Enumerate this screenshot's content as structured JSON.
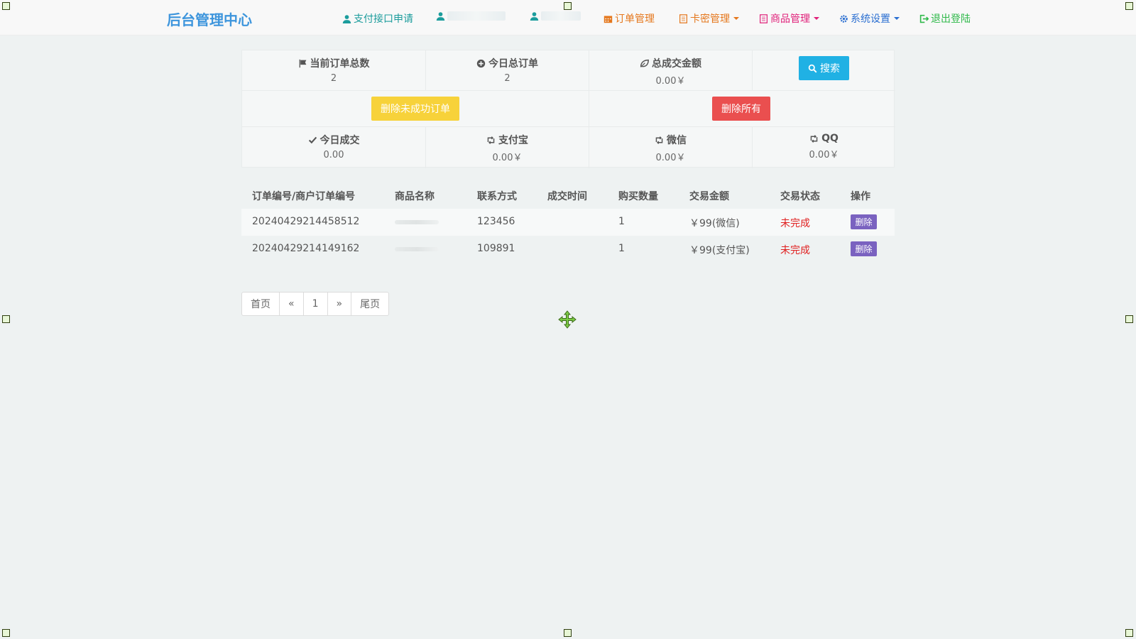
{
  "navbar": {
    "brand": "后台管理中心",
    "items": [
      {
        "label": "支付接口申请",
        "icon": "user-icon"
      },
      {
        "label": "",
        "icon": "user-icon"
      },
      {
        "label": "",
        "icon": "user-icon"
      },
      {
        "label": "订单管理",
        "icon": "calendar-icon"
      },
      {
        "label": "卡密管理",
        "icon": "list-icon"
      },
      {
        "label": "商品管理",
        "icon": "list-icon"
      },
      {
        "label": "系统设置",
        "icon": "gear-icon"
      },
      {
        "label": "退出登陆",
        "icon": "logout-icon"
      }
    ],
    "colors": {
      "brand": "#3d95dc",
      "teal": "#1b9c9c",
      "orange": "#e5771d",
      "pink": "#e0217a",
      "blue": "#2b6fd1",
      "green": "#2fb94a"
    }
  },
  "stats": {
    "current_orders": {
      "label": "当前订单总数",
      "value": "2",
      "icon": "flag-icon"
    },
    "today_orders": {
      "label": "今日总订单",
      "value": "2",
      "icon": "plus-circle-icon"
    },
    "total_amount": {
      "label": "总成交金额",
      "value": "0.00￥",
      "icon": "leaf-icon"
    },
    "search_label": "搜索",
    "delete_failed_label": "删除未成功订单",
    "delete_all_label": "删除所有",
    "today_deal": {
      "label": "今日成交",
      "value": "0.00",
      "icon": "check-icon"
    },
    "alipay": {
      "label": "支付宝",
      "value": "0.00￥",
      "icon": "retweet-icon"
    },
    "wechat": {
      "label": "微信",
      "value": "0.00￥",
      "icon": "retweet-icon"
    },
    "qq": {
      "label": "QQ",
      "value": "0.00￥",
      "icon": "retweet-icon"
    }
  },
  "table": {
    "headers": [
      "订单编号/商户订单编号",
      "商品名称",
      "联系方式",
      "成交时间",
      "购买数量",
      "交易金额",
      "交易状态",
      "操作"
    ],
    "rows": [
      {
        "order_no": "20240429214458512",
        "product": "",
        "contact": "123456",
        "time": "",
        "qty": "1",
        "amount": "￥99(微信)",
        "status": "未完成",
        "action": "删除"
      },
      {
        "order_no": "20240429214149162",
        "product": "",
        "contact": "109891",
        "time": "",
        "qty": "1",
        "amount": "￥99(支付宝)",
        "status": "未完成",
        "action": "删除"
      }
    ],
    "status_color": "#e02020"
  },
  "pagination": {
    "first": "首页",
    "prev": "«",
    "current": "1",
    "next": "»",
    "last": "尾页"
  }
}
